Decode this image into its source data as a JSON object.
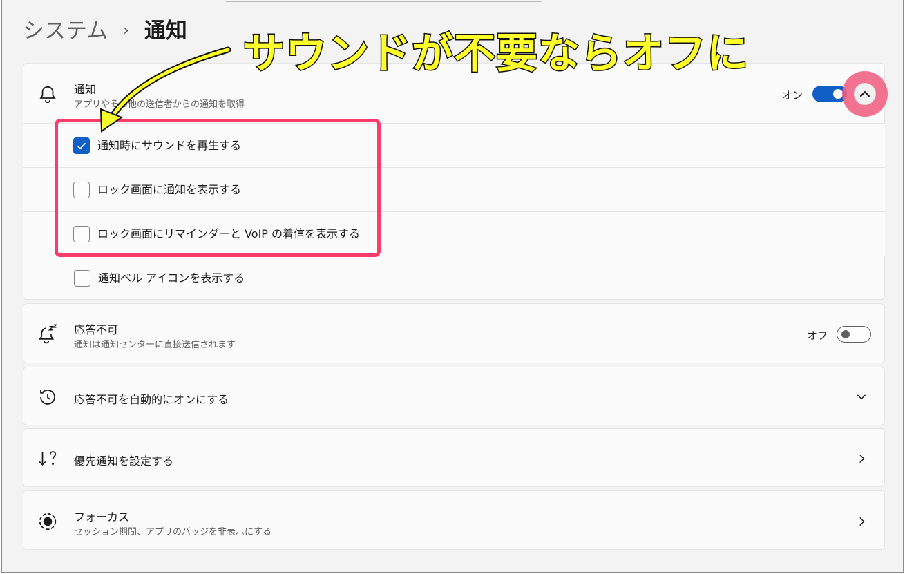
{
  "breadcrumb": {
    "parent": "システム",
    "separator": "›",
    "current": "通知"
  },
  "annotation": {
    "callout": "サウンドが不要ならオフに",
    "highlight_color": "#ff3a6c",
    "callout_color": "#ffff2a"
  },
  "notifications": {
    "title": "通知",
    "subtitle": "アプリやその他の送信者からの通知を取得",
    "toggle_label": "オン",
    "toggle_on": true,
    "icon": "bell-icon",
    "options": [
      {
        "label": "通知時にサウンドを再生する",
        "checked": true
      },
      {
        "label": "ロック画面に通知を表示する",
        "checked": false
      },
      {
        "label": "ロック画面にリマインダーと VoIP の着信を表示する",
        "checked": false
      },
      {
        "label": "通知ベル アイコンを表示する",
        "checked": false
      }
    ]
  },
  "do_not_disturb": {
    "title": "応答不可",
    "subtitle": "通知は通知センターに直接送信されます",
    "toggle_label": "オフ",
    "toggle_on": false,
    "icon": "bell-snooze-icon"
  },
  "auto_dnd": {
    "title": "応答不可を自動的にオンにする",
    "icon": "clock-icon"
  },
  "priority": {
    "title": "優先通知を設定する",
    "icon": "priority-sort-icon"
  },
  "focus": {
    "title": "フォーカス",
    "subtitle": "セッション期間、アプリのバッジを非表示にする",
    "icon": "focus-icon"
  },
  "colors": {
    "accent": "#0f5fc7",
    "background": "#f3f3f3",
    "card": "#fbfbfb"
  }
}
